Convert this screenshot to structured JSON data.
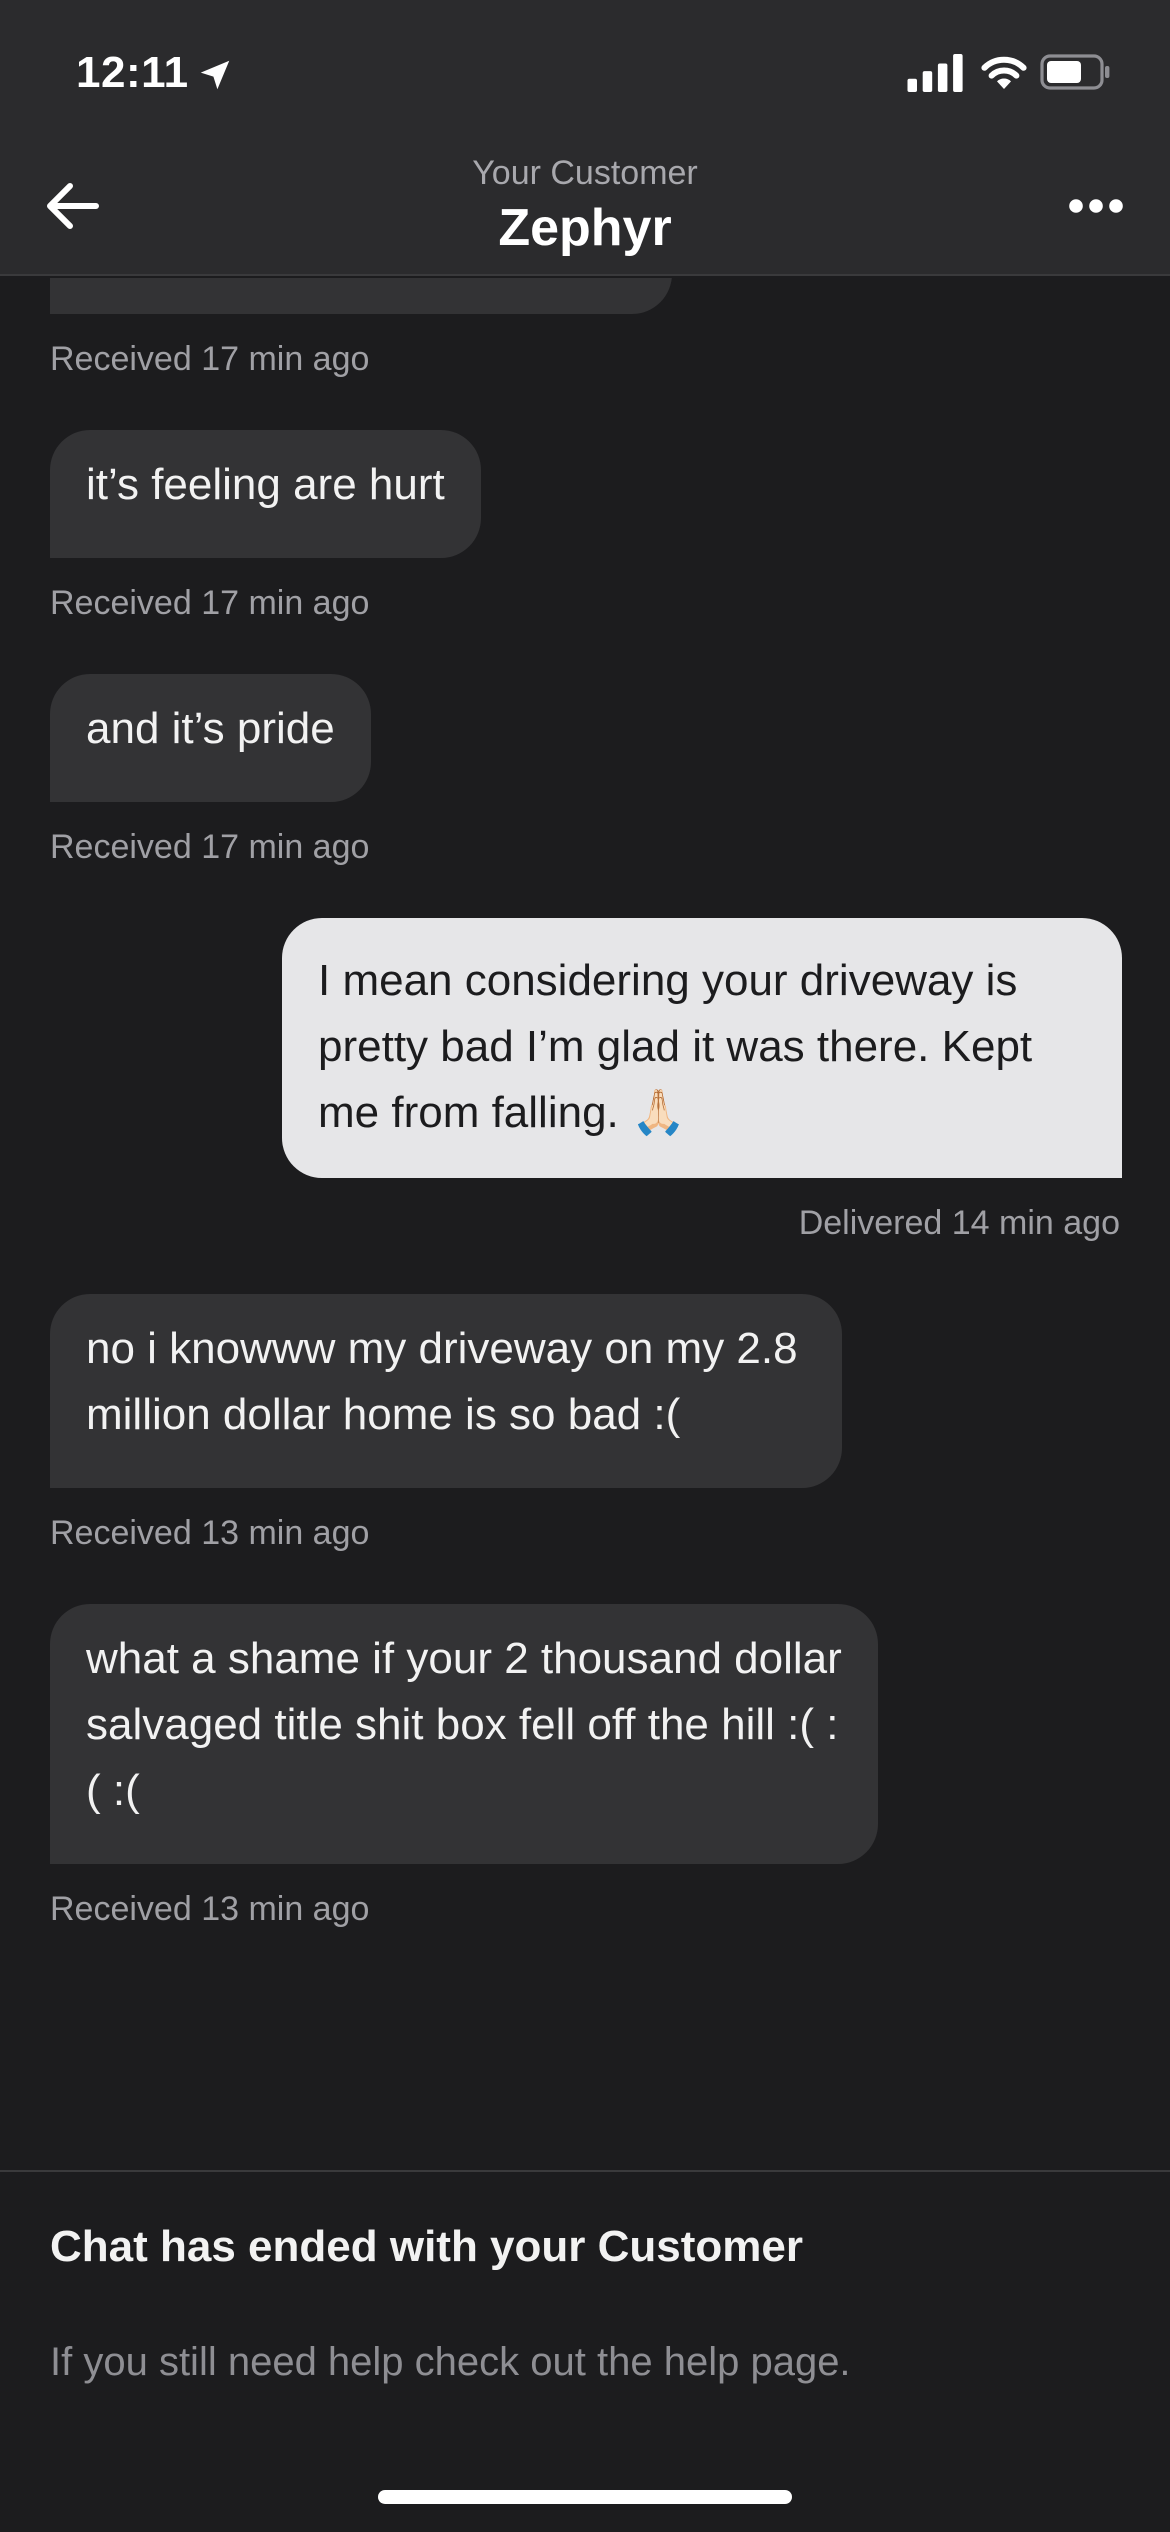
{
  "status_bar": {
    "time": "12:11",
    "icons": [
      "location-arrow-icon",
      "signal-icon",
      "wifi-icon",
      "battery-icon"
    ]
  },
  "header": {
    "subtitle": "Your Customer",
    "title": "Zephyr",
    "back_icon": "back-arrow-icon",
    "more_icon": "more-icon"
  },
  "messages": [
    {
      "direction": "in",
      "text": "",
      "meta": "Received 17 min ago"
    },
    {
      "direction": "in",
      "text": "it’s feeling are hurt",
      "meta": "Received 17 min ago"
    },
    {
      "direction": "in",
      "text": "and it’s pride",
      "meta": "Received 17 min ago"
    },
    {
      "direction": "out",
      "text": "I mean considering your driveway is pretty bad I’m glad it was there. Kept me from falling. 🙏🏻",
      "meta": "Delivered 14 min ago"
    },
    {
      "direction": "in",
      "text": "no i knowww my driveway on my 2.8 million dollar home is so bad :(",
      "meta": "Received 13 min ago"
    },
    {
      "direction": "in",
      "text": "what a shame if your 2 thousand dollar salvaged title shit box fell off the hill :( :( :(",
      "meta": "Received 13 min ago"
    }
  ],
  "footer": {
    "ended_title": "Chat has ended with your Customer",
    "help_text": "If you still need help check out the help page."
  },
  "colors": {
    "background": "#1c1c1e",
    "header": "#2b2b2d",
    "incoming_bubble": "#333335",
    "outgoing_bubble": "#e6e6e8"
  }
}
